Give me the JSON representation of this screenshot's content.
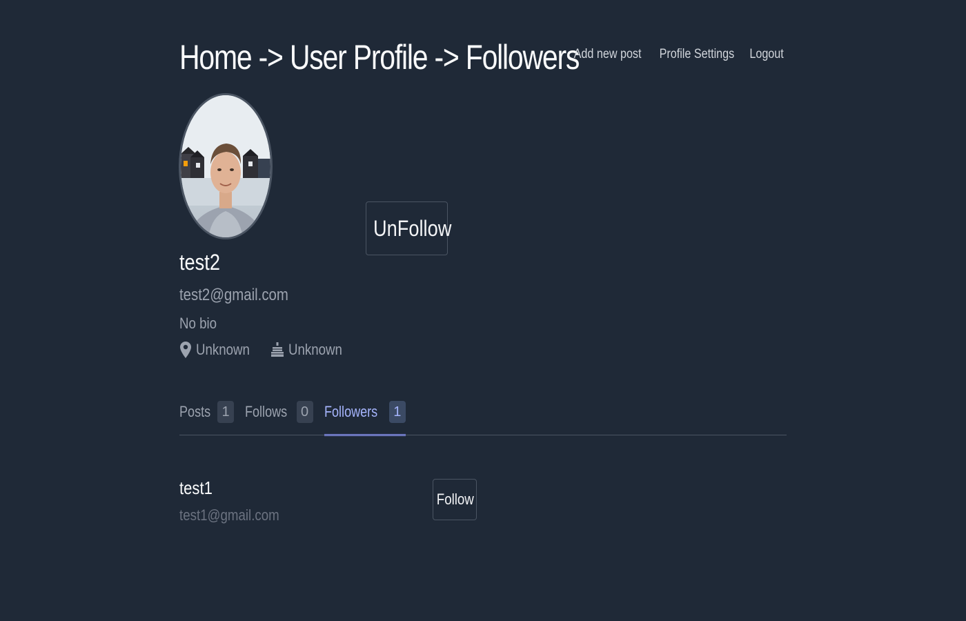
{
  "header": {
    "breadcrumb": "Home -> User Profile -> Followers",
    "nav": {
      "add_post": "Add new post",
      "profile_settings": "Profile Settings",
      "logout": "Logout"
    }
  },
  "profile": {
    "username": "test2",
    "email": "test2@gmail.com",
    "bio": "No bio",
    "location": "Unknown",
    "birthday": "Unknown",
    "unfollow_label": "UnFollow"
  },
  "tabs": [
    {
      "label": "Posts",
      "count": "1",
      "active": false
    },
    {
      "label": "Follows",
      "count": "0",
      "active": false
    },
    {
      "label": "Followers",
      "count": "1",
      "active": true
    }
  ],
  "followers": [
    {
      "name": "test1",
      "email": "test1@gmail.com",
      "button_label": "Follow"
    }
  ],
  "colors": {
    "background": "#1f2937",
    "accent": "#818cf8",
    "border": "#4b5563"
  }
}
